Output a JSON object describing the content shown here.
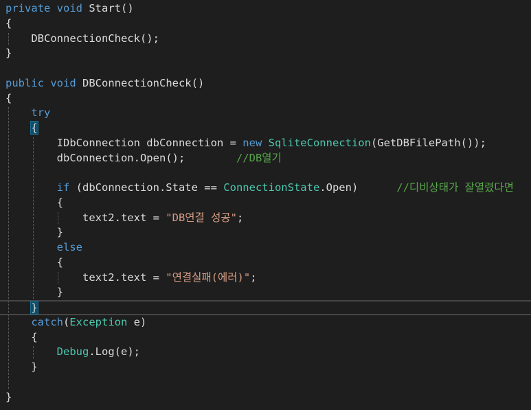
{
  "editor": {
    "lines": [
      {
        "tokens": [
          {
            "t": "private",
            "c": "kw"
          },
          {
            "t": " ",
            "c": "pl"
          },
          {
            "t": "void",
            "c": "kw"
          },
          {
            "t": " Start()",
            "c": "pl"
          }
        ]
      },
      {
        "tokens": [
          {
            "t": "{",
            "c": "pl"
          }
        ]
      },
      {
        "tokens": [
          {
            "t": "    DBConnectionCheck();",
            "c": "pl"
          }
        ]
      },
      {
        "tokens": [
          {
            "t": "}",
            "c": "pl"
          }
        ]
      },
      {
        "tokens": []
      },
      {
        "tokens": [
          {
            "t": "public",
            "c": "kw"
          },
          {
            "t": " ",
            "c": "pl"
          },
          {
            "t": "void",
            "c": "kw"
          },
          {
            "t": " DBConnectionCheck()",
            "c": "pl"
          }
        ]
      },
      {
        "tokens": [
          {
            "t": "{",
            "c": "pl"
          }
        ]
      },
      {
        "tokens": [
          {
            "t": "    ",
            "c": "pl"
          },
          {
            "t": "try",
            "c": "kw"
          }
        ]
      },
      {
        "tokens": [
          {
            "t": "    ",
            "c": "pl"
          },
          {
            "t": "{",
            "c": "hl"
          }
        ]
      },
      {
        "tokens": [
          {
            "t": "        IDbConnection dbConnection = ",
            "c": "pl"
          },
          {
            "t": "new",
            "c": "kw"
          },
          {
            "t": " ",
            "c": "pl"
          },
          {
            "t": "SqliteConnection",
            "c": "type"
          },
          {
            "t": "(GetDBFilePath());",
            "c": "pl"
          }
        ]
      },
      {
        "tokens": [
          {
            "t": "        dbConnection.Open();        ",
            "c": "pl"
          },
          {
            "t": "//DB열기",
            "c": "cm"
          }
        ]
      },
      {
        "tokens": []
      },
      {
        "tokens": [
          {
            "t": "        ",
            "c": "pl"
          },
          {
            "t": "if",
            "c": "kw"
          },
          {
            "t": " (dbConnection.State == ",
            "c": "pl"
          },
          {
            "t": "ConnectionState",
            "c": "type"
          },
          {
            "t": ".Open)      ",
            "c": "pl"
          },
          {
            "t": "//디비상태가 잘열렸다면",
            "c": "cm"
          }
        ]
      },
      {
        "tokens": [
          {
            "t": "        {",
            "c": "pl"
          }
        ]
      },
      {
        "tokens": [
          {
            "t": "            text2.text = ",
            "c": "pl"
          },
          {
            "t": "\"DB연결 성공\"",
            "c": "str"
          },
          {
            "t": ";",
            "c": "pl"
          }
        ]
      },
      {
        "tokens": [
          {
            "t": "        }",
            "c": "pl"
          }
        ]
      },
      {
        "tokens": [
          {
            "t": "        ",
            "c": "pl"
          },
          {
            "t": "else",
            "c": "kw"
          }
        ]
      },
      {
        "tokens": [
          {
            "t": "        {",
            "c": "pl"
          }
        ]
      },
      {
        "tokens": [
          {
            "t": "            text2.text = ",
            "c": "pl"
          },
          {
            "t": "\"연결실패(에러)\"",
            "c": "str"
          },
          {
            "t": ";",
            "c": "pl"
          }
        ]
      },
      {
        "tokens": [
          {
            "t": "        }",
            "c": "pl"
          }
        ]
      },
      {
        "tokens": [
          {
            "t": "    ",
            "c": "pl"
          },
          {
            "t": "}",
            "c": "hl"
          }
        ],
        "current": true
      },
      {
        "tokens": [
          {
            "t": "    ",
            "c": "pl"
          },
          {
            "t": "catch",
            "c": "kw"
          },
          {
            "t": "(",
            "c": "pl"
          },
          {
            "t": "Exception",
            "c": "type"
          },
          {
            "t": " e)",
            "c": "pl"
          }
        ]
      },
      {
        "tokens": [
          {
            "t": "    {",
            "c": "pl"
          }
        ]
      },
      {
        "tokens": [
          {
            "t": "        ",
            "c": "pl"
          },
          {
            "t": "Debug",
            "c": "type"
          },
          {
            "t": ".Log(e);",
            "c": "pl"
          }
        ]
      },
      {
        "tokens": [
          {
            "t": "    }",
            "c": "pl"
          }
        ]
      },
      {
        "tokens": []
      },
      {
        "tokens": [
          {
            "t": "}",
            "c": "pl"
          }
        ]
      }
    ],
    "colors": {
      "background": "#1e1e1e",
      "keyword": "#569cd6",
      "type": "#4ec9b0",
      "string": "#d69d85",
      "comment": "#57a64a",
      "plain": "#dcdcdc"
    }
  }
}
